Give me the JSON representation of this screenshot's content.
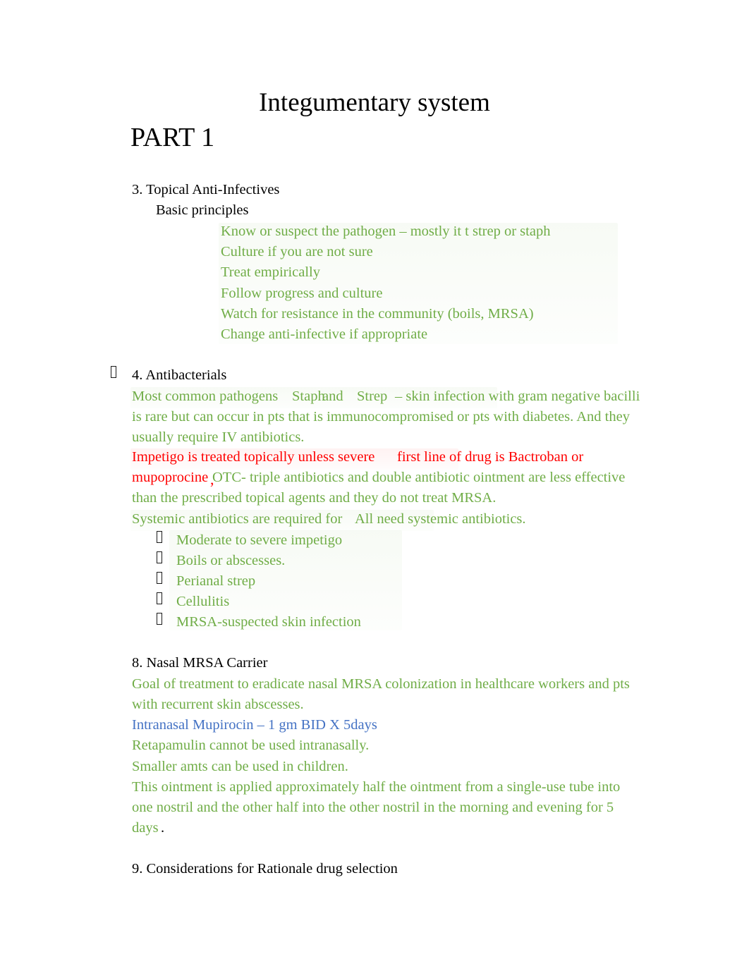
{
  "document": {
    "title": "Integumentary system",
    "part": "PART 1"
  },
  "sections": {
    "topical": {
      "heading": "3. Topical Anti-Infectives",
      "subheading": "Basic principles",
      "principles": [
        "Know or suspect the pathogen – mostly it t strep or staph",
        "Culture if you are not sure",
        "Treat empirically",
        "Follow progress and culture",
        "Watch for resistance in the community (boils, MRSA)",
        "Change anti-infective if appropriate"
      ]
    },
    "antibacterials": {
      "bullet_glyph": "missing-glyph-box",
      "heading": "4. Antibacterials",
      "pathogen_line": {
        "lead": "Most common pathogens",
        "organism_1": "Staph",
        "conjunction": "and",
        "organism_2": "Strep",
        "tail": "– skin infection with gram negative bacilli"
      },
      "body_lines": [
        "is rare but can occur in pts that is immunocompromised or pts with diabetes. And they",
        "usually require IV antibiotics."
      ],
      "impetigo_line": {
        "part_1": "Impetigo is treated topically unless severe",
        "part_2": "first line of drug is Bactroban or"
      },
      "mupirocin_line": {
        "drug": "mupoprocine",
        "comma": ",",
        "otc_text": "OTC- triple antibiotics and double antibiotic ointment are less effective"
      },
      "otc_continuation": "than the prescribed topical agents and they do not treat MRSA.",
      "systemic_line": {
        "part_1": "Systemic antibiotics are required for",
        "part_2": "All need systemic antibiotics."
      },
      "indications": [
        "Moderate to severe impetigo",
        "Boils or abscesses.",
        "Perianal strep",
        "Cellulitis",
        "MRSA-suspected skin infection"
      ]
    },
    "nasal_mrsa": {
      "heading": "8. Nasal MRSA Carrier",
      "goal_lines": [
        "Goal of treatment to eradicate nasal MRSA colonization in healthcare workers and pts",
        "with recurrent skin abscesses."
      ],
      "regimen": "Intranasal Mupirocin – 1 gm BID X 5days",
      "notes": [
        "Retapamulin cannot be used intranasally.",
        "Smaller amts can be used in children."
      ],
      "application_lines": [
        "This ointment is applied approximately half the ointment from a single-use tube into",
        "one nostril and the other half into the other nostril in the morning and evening for 5",
        "days"
      ],
      "application_terminator": "."
    },
    "rationale": {
      "heading": "9. Considerations for Rationale drug selection"
    }
  },
  "colors": {
    "green": "#70AD47",
    "red": "#FF0000",
    "blue": "#4472C4",
    "black": "#000000"
  }
}
